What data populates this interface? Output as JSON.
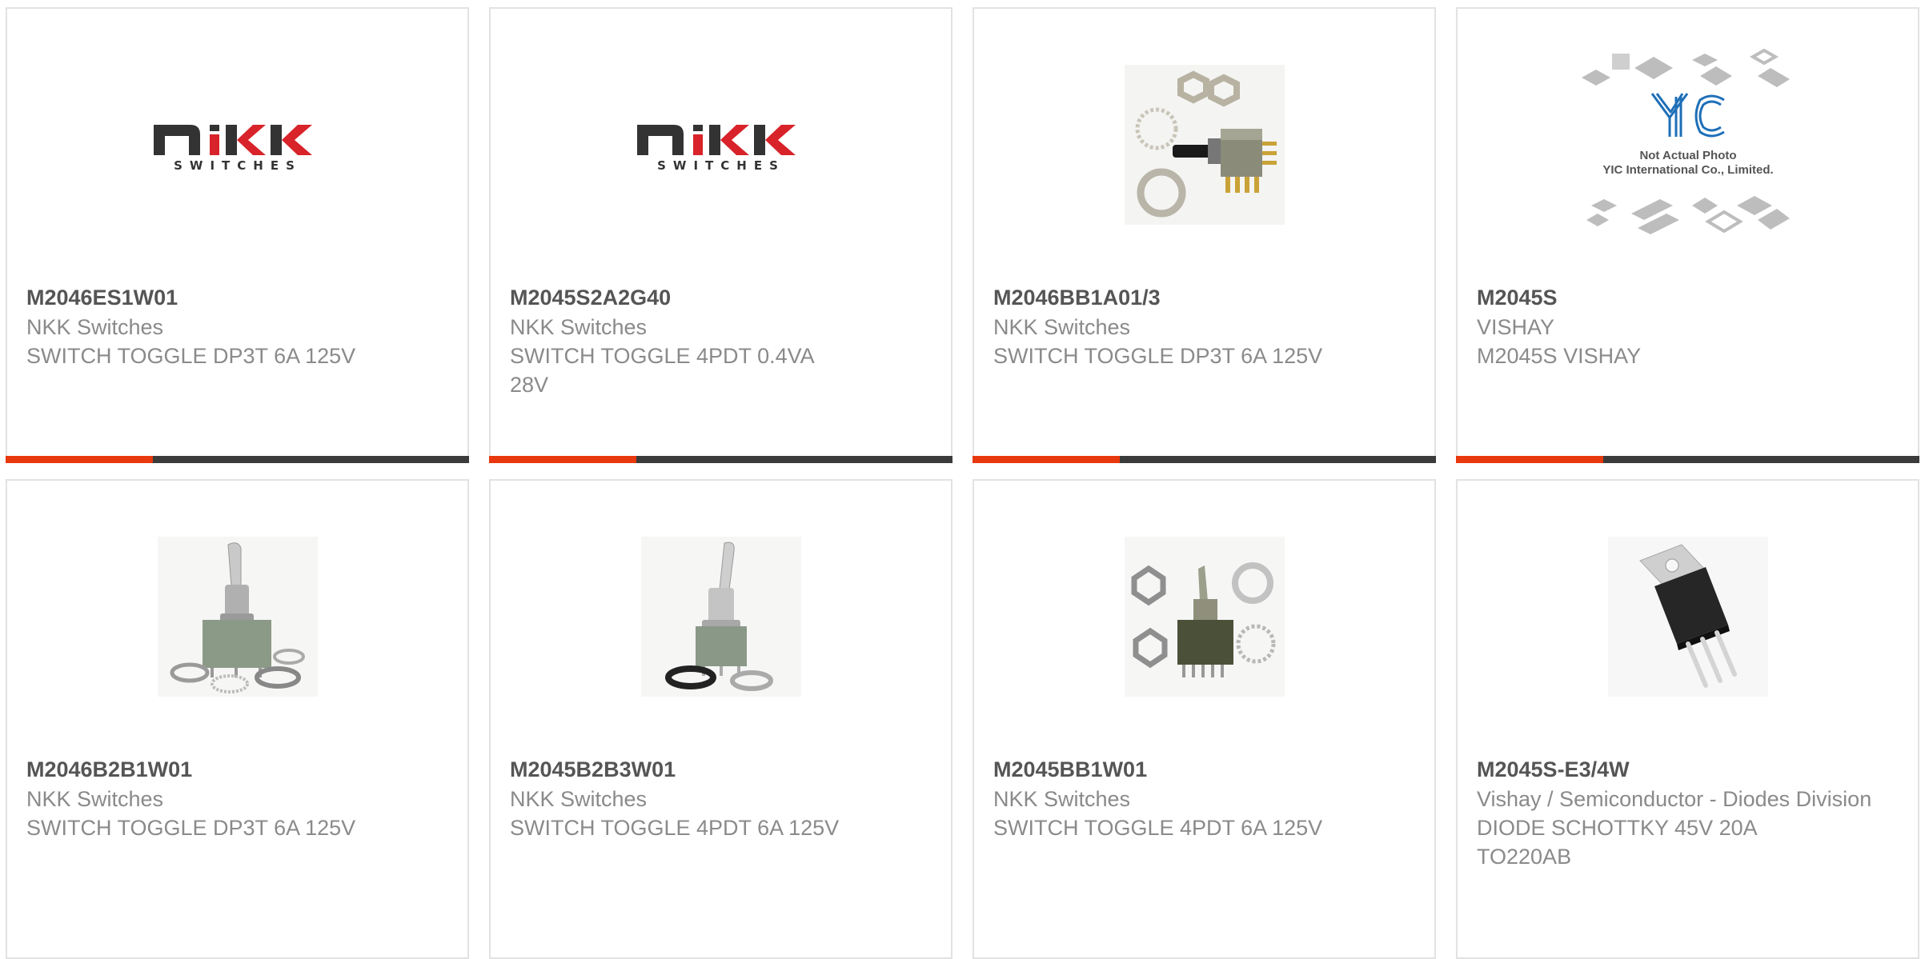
{
  "products": [
    {
      "part_number": "M2046ES1W01",
      "manufacturer": "NKK Switches",
      "description": "SWITCH TOGGLE DP3T 6A 125V",
      "image": "nkk-logo"
    },
    {
      "part_number": "M2045S2A2G40",
      "manufacturer": "NKK Switches",
      "description": "SWITCH TOGGLE 4PDT 0.4VA 28V",
      "image": "nkk-logo"
    },
    {
      "part_number": "M2046BB1A01/3",
      "manufacturer": "NKK Switches",
      "description": "SWITCH TOGGLE DP3T 6A 125V",
      "image": "toggle-switch-photo"
    },
    {
      "part_number": "M2045S",
      "manufacturer": "VISHAY",
      "description": "M2045S VISHAY",
      "image": "yic-placeholder",
      "placeholder_line1": "Not Actual Photo",
      "placeholder_line2": "YIC International Co., Limited."
    },
    {
      "part_number": "M2046B2B1W01",
      "manufacturer": "NKK Switches",
      "description": "SWITCH TOGGLE DP3T 6A 125V",
      "image": "toggle-switch-photo"
    },
    {
      "part_number": "M2045B2B3W01",
      "manufacturer": "NKK Switches",
      "description": "SWITCH TOGGLE 4PDT 6A 125V",
      "image": "toggle-switch-photo"
    },
    {
      "part_number": "M2045BB1W01",
      "manufacturer": "NKK Switches",
      "description": "SWITCH TOGGLE 4PDT 6A 125V",
      "image": "toggle-switch-photo"
    },
    {
      "part_number": "M2045S-E3/4W",
      "manufacturer": "Vishay / Semiconductor - Diodes Division",
      "description": "DIODE SCHOTTKY 45V 20A TO220AB",
      "image": "to220-diode-photo"
    }
  ],
  "logo": {
    "nkk_top": "NKK",
    "nkk_bottom": "SWITCHES",
    "yic": "YIC"
  },
  "colors": {
    "accent": "#e8380d",
    "bar": "#3b3b3b",
    "logo_dark": "#333333",
    "logo_red": "#d8232a",
    "yic_blue": "#1e6fb8"
  }
}
